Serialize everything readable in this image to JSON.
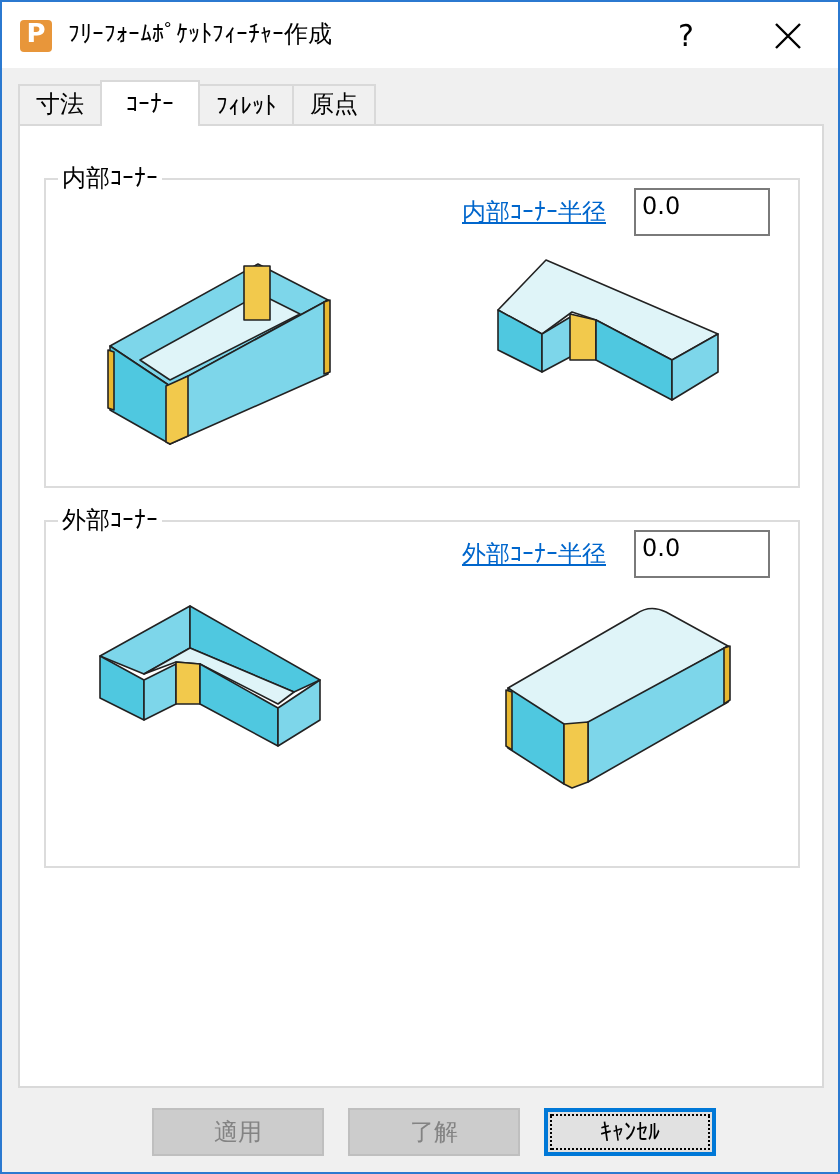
{
  "window": {
    "logo": "P",
    "title": "ﾌﾘｰﾌｫｰﾑﾎﾟｹｯﾄﾌｨｰﾁｬｰ作成",
    "help": "?"
  },
  "tabs": [
    {
      "label": "寸法",
      "selected": false
    },
    {
      "label": "ｺｰﾅｰ",
      "selected": true
    },
    {
      "label": "ﾌｨﾚｯﾄ",
      "selected": false
    },
    {
      "label": "原点",
      "selected": false
    }
  ],
  "groups": [
    {
      "title": "内部ｺｰﾅｰ",
      "link": "内部ｺｰﾅｰ半径",
      "value": "0.0"
    },
    {
      "title": "外部ｺｰﾅｰ",
      "link": "外部ｺｰﾅｰ半径",
      "value": "0.0"
    }
  ],
  "buttons": [
    {
      "label": "適用",
      "disabled": true,
      "focused": false
    },
    {
      "label": "了解",
      "disabled": true,
      "focused": false
    },
    {
      "label": "ｷｬﾝｾﾙ",
      "disabled": false,
      "focused": true
    }
  ]
}
